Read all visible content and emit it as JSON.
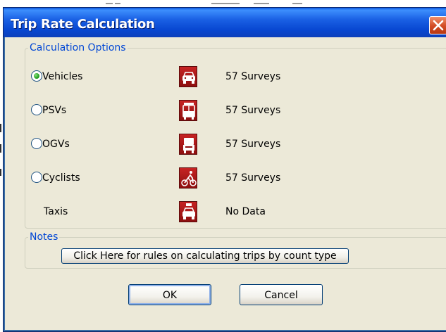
{
  "dialog": {
    "title": "Trip Rate Calculation"
  },
  "calculation_options": {
    "legend": "Calculation Options",
    "selected": "Vehicles",
    "options": [
      {
        "label": "Vehicles",
        "selected": true,
        "icon": "car-icon",
        "surveys": "57 Surveys"
      },
      {
        "label": "PSVs",
        "selected": false,
        "icon": "bus-icon",
        "surveys": "57 Surveys"
      },
      {
        "label": "OGVs",
        "selected": false,
        "icon": "truck-icon",
        "surveys": "57 Surveys"
      },
      {
        "label": "Cyclists",
        "selected": false,
        "icon": "cyclist-icon",
        "surveys": "57 Surveys"
      },
      {
        "label": "Taxis",
        "selected": false,
        "icon": "taxi-icon",
        "surveys": "No Data"
      }
    ]
  },
  "notes": {
    "legend": "Notes",
    "rules_button_label": "Click Here for rules on calculating trips by count type"
  },
  "buttons": {
    "ok_label": "OK",
    "cancel_label": "Cancel"
  },
  "colors": {
    "titlebar": "#0a56e1",
    "legend_text": "#0046d5",
    "icon_red": "#b21a1a",
    "dialog_bg": "#ece9d8"
  }
}
